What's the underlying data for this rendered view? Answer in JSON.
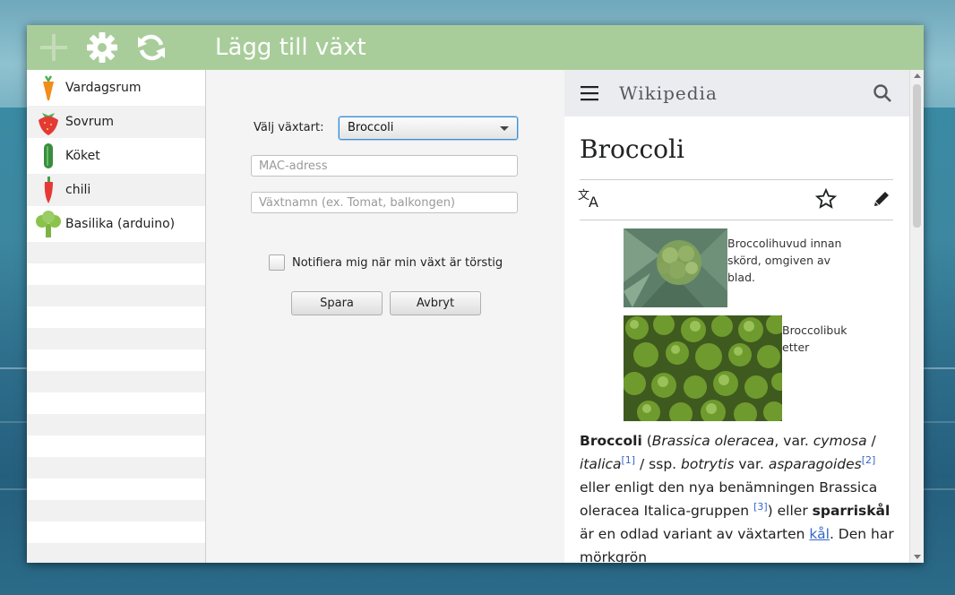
{
  "toolbar": {
    "title": "Lägg till växt",
    "icons": [
      "plus-icon",
      "gear-icon",
      "refresh-icon"
    ],
    "bg_color": "#a8cd9a"
  },
  "sidebar": {
    "items": [
      {
        "label": "Vardagsrum",
        "icon": "carrot-icon"
      },
      {
        "label": "Sovrum",
        "icon": "strawberry-icon"
      },
      {
        "label": "Köket",
        "icon": "cucumber-icon"
      },
      {
        "label": "chili",
        "icon": "chili-icon"
      },
      {
        "label": "Basilika (arduino)",
        "icon": "broccoli-icon"
      }
    ]
  },
  "form": {
    "plant_type_label": "Välj växtart:",
    "plant_type_value": "Broccoli",
    "mac_placeholder": "MAC-adress",
    "name_placeholder": "Växtnamn (ex. Tomat, balkongen)",
    "notify_label": "Notifiera mig när min växt är törstig",
    "notify_checked": false,
    "save_label": "Spara",
    "cancel_label": "Avbryt"
  },
  "wiki": {
    "logo": "Wikipedia",
    "title": "Broccoli",
    "caption1": "Broccolihuvud innan skörd, omgiven av blad.",
    "caption2_line1": "Broccolibuk",
    "caption2_line2": "etter",
    "article": {
      "t1": "Broccoli",
      "t2": " (",
      "t3": "Brassica oleracea",
      "t4": ", var. ",
      "t5": "cymosa",
      "t6": " / ",
      "t7": "italica",
      "ref1": "[1]",
      "t8": " / ssp. ",
      "t9": "botrytis",
      "t10": " var. ",
      "t11": "asparagoides",
      "ref2": "[2]",
      "t12": " eller enligt den nya benämningen Brassica oleracea Italica-gruppen ",
      "ref3": "[3]",
      "t13": ") eller ",
      "t14": "sparriskål",
      "t15": " är en odlad variant av växtarten ",
      "link1": "kål",
      "t16": ". Den har mörkgrön"
    }
  }
}
